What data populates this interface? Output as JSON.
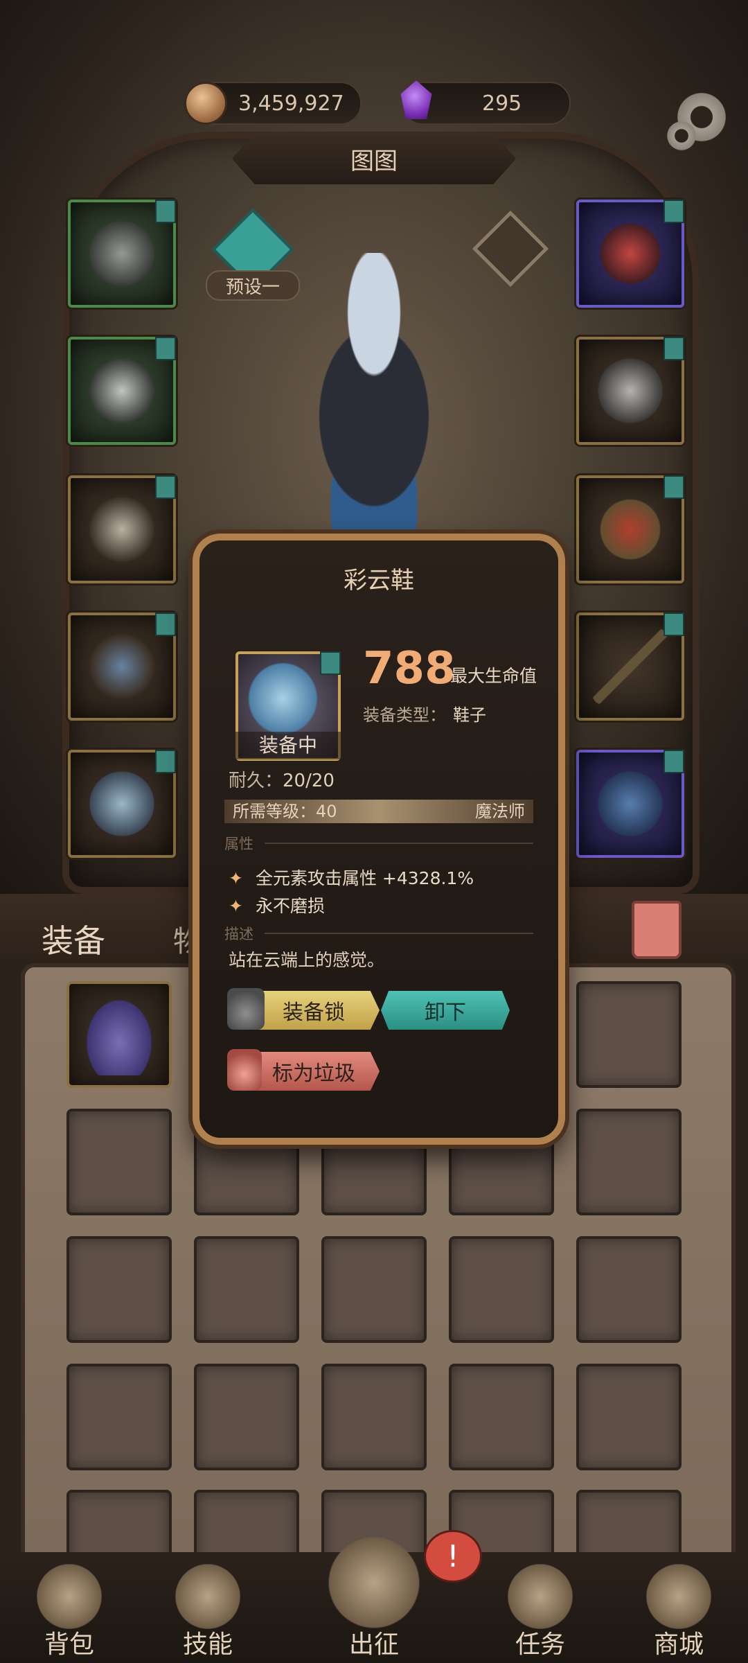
{
  "currency": {
    "gold": "3,459,927",
    "gems": "295"
  },
  "header": {
    "title": "图图"
  },
  "preset": {
    "label": "预设一"
  },
  "tabs": {
    "equipment": "装备",
    "items": "物品"
  },
  "popup": {
    "item_name": "彩云鞋",
    "status": "装备中",
    "main_stat_value": "788",
    "main_stat_label": "最大生命值",
    "type_label": "装备类型：",
    "type_value": "鞋子",
    "durability_label": "耐久：",
    "durability_value": "20/20",
    "required_level": "所需等级：40",
    "class": "魔法师",
    "section_attributes": "属性",
    "attributes": [
      "全元素攻击属性 +4328.1%",
      "永不磨损"
    ],
    "section_description": "描述",
    "description": "站在云端上的感觉。",
    "buttons": {
      "lock": "装备锁",
      "unequip": "卸下",
      "mark_trash": "标为垃圾"
    }
  },
  "bottom_nav": {
    "items": [
      {
        "label": "背包"
      },
      {
        "label": "技能"
      },
      {
        "label": "出征"
      },
      {
        "label": "任务"
      },
      {
        "label": "商城"
      }
    ],
    "alert": "!"
  },
  "colors": {
    "accent_gold": "#b0814c",
    "stat_orange": "#f1ab74",
    "teal_button": "#4ec2b4",
    "yellow_button": "#e7d27a",
    "red_button": "#e38a7f"
  }
}
